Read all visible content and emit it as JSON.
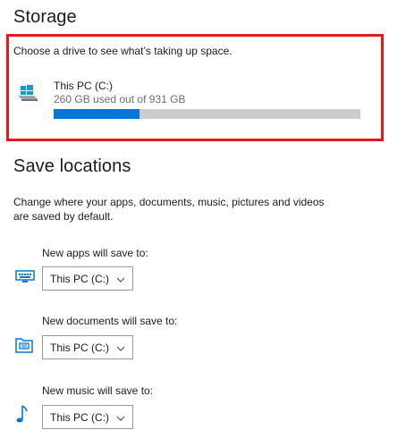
{
  "storage": {
    "title": "Storage",
    "description": "Choose a drive to see what’s taking up space.",
    "drive": {
      "icon": "drive-windows-icon",
      "name": "This PC (C:)",
      "usage": "260 GB used out of 931 GB",
      "used_fraction": 0.279
    }
  },
  "save_locations": {
    "title": "Save locations",
    "description_line1": "Change where your apps, documents, music, pictures and videos",
    "description_line2": "are saved by default.",
    "items": [
      {
        "label": "New apps will save to:",
        "icon": "monitor-keyboard-icon",
        "value": "This PC (C:)"
      },
      {
        "label": "New documents will save to:",
        "icon": "document-folder-icon",
        "value": "This PC (C:)"
      },
      {
        "label": "New music will save to:",
        "icon": "music-note-icon",
        "value": "This PC (C:)"
      }
    ]
  },
  "colors": {
    "accent": "#0078d7",
    "highlight_border": "#e3191e",
    "bar_track": "#cccccc"
  }
}
